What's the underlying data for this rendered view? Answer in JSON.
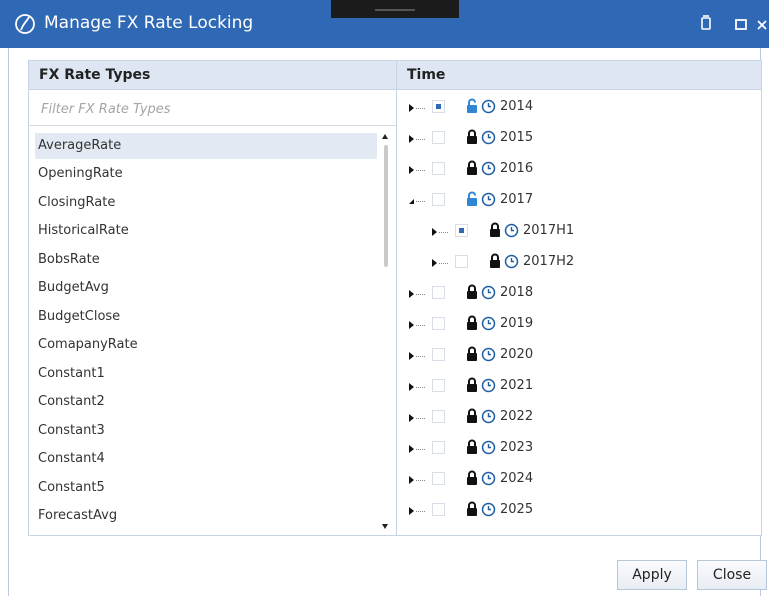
{
  "window": {
    "title": "Manage FX Rate Locking",
    "colors": {
      "titlebar": "#2f68b4",
      "header": "#dde6f2",
      "accent": "#2f86d4"
    },
    "icons": [
      "app-logo-icon",
      "pin-icon",
      "maximize-icon",
      "close-icon"
    ]
  },
  "left": {
    "header": "FX Rate Types",
    "filter_placeholder": "Filter FX Rate Types",
    "items": [
      {
        "label": "AverageRate",
        "selected": true
      },
      {
        "label": "OpeningRate"
      },
      {
        "label": "ClosingRate"
      },
      {
        "label": "HistoricalRate"
      },
      {
        "label": "BobsRate"
      },
      {
        "label": "BudgetAvg"
      },
      {
        "label": "BudgetClose"
      },
      {
        "label": "ComapanyRate"
      },
      {
        "label": "Constant1"
      },
      {
        "label": "Constant2"
      },
      {
        "label": "Constant3"
      },
      {
        "label": "Constant4"
      },
      {
        "label": "Constant5"
      },
      {
        "label": "ForecastAvg"
      }
    ]
  },
  "right": {
    "header": "Time",
    "rows": [
      {
        "label": "2014",
        "level": 0,
        "state": "collapsed",
        "check": "partial",
        "lock": "open-blue"
      },
      {
        "label": "2015",
        "level": 0,
        "state": "collapsed",
        "check": "none",
        "lock": "locked"
      },
      {
        "label": "2016",
        "level": 0,
        "state": "collapsed",
        "check": "none",
        "lock": "locked"
      },
      {
        "label": "2017",
        "level": 0,
        "state": "expanded",
        "check": "none",
        "lock": "open-blue"
      },
      {
        "label": "2017H1",
        "level": 1,
        "state": "collapsed",
        "check": "partial",
        "lock": "locked"
      },
      {
        "label": "2017H2",
        "level": 1,
        "state": "collapsed",
        "check": "none",
        "lock": "locked"
      },
      {
        "label": "2018",
        "level": 0,
        "state": "collapsed",
        "check": "none",
        "lock": "locked"
      },
      {
        "label": "2019",
        "level": 0,
        "state": "collapsed",
        "check": "none",
        "lock": "locked"
      },
      {
        "label": "2020",
        "level": 0,
        "state": "collapsed",
        "check": "none",
        "lock": "locked"
      },
      {
        "label": "2021",
        "level": 0,
        "state": "collapsed",
        "check": "none",
        "lock": "locked"
      },
      {
        "label": "2022",
        "level": 0,
        "state": "collapsed",
        "check": "none",
        "lock": "locked"
      },
      {
        "label": "2023",
        "level": 0,
        "state": "collapsed",
        "check": "none",
        "lock": "locked"
      },
      {
        "label": "2024",
        "level": 0,
        "state": "collapsed",
        "check": "none",
        "lock": "locked"
      },
      {
        "label": "2025",
        "level": 0,
        "state": "collapsed",
        "check": "none",
        "lock": "locked"
      }
    ]
  },
  "buttons": {
    "apply": "Apply",
    "close": "Close"
  }
}
